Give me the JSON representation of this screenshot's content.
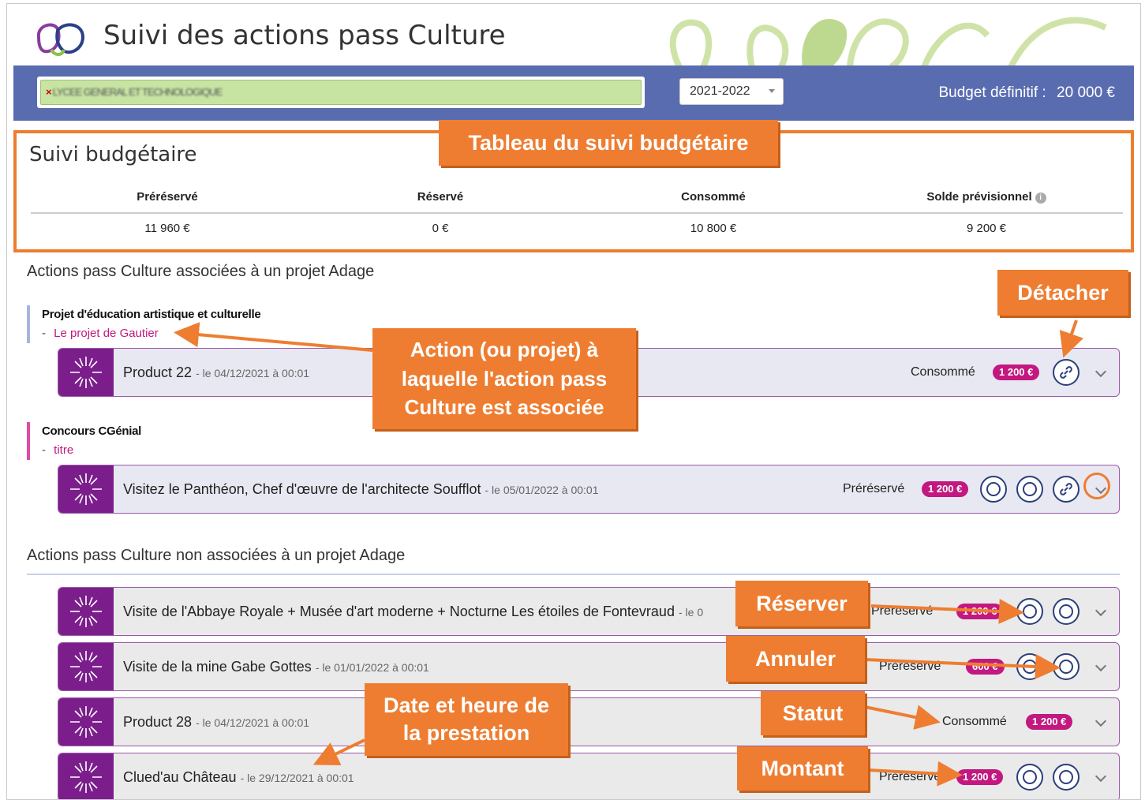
{
  "header": {
    "title": "Suivi des actions pass Culture"
  },
  "toolbar": {
    "establishment_value": "LYCEE GENERAL ET TECHNOLOGIQUE",
    "year_value": "2021-2022",
    "budget_label": "Budget définitif :",
    "budget_value": "20 000 €"
  },
  "budget_tracking": {
    "title": "Suivi budgétaire",
    "columns": [
      "Préréservé",
      "Réservé",
      "Consommé",
      "Solde prévisionnel"
    ],
    "values": [
      "11 960 €",
      "0 €",
      "10 800 €",
      "9 200 €"
    ]
  },
  "sections": {
    "associated": "Actions pass Culture associées à un projet Adage",
    "non_associated": "Actions pass Culture non associées à un projet Adage"
  },
  "projects": [
    {
      "type": "Projet d'éducation artistique et culturelle",
      "name": "Le projet de Gautier"
    },
    {
      "type": "Concours CGénial",
      "name": "titre"
    }
  ],
  "actions": [
    {
      "title": "Product 22",
      "date": "le 04/12/2021 à 00:01",
      "status": "Consommé",
      "amount": "1 200 €"
    },
    {
      "title": "Visitez le Panthéon, Chef d'œuvre de l'architecte Soufflot",
      "date": "le 05/01/2022 à 00:01",
      "status": "Préréservé",
      "amount": "1 200 €"
    },
    {
      "title": "Visite de l'Abbaye Royale + Musée d'art moderne + Nocturne Les étoiles de Fontevraud",
      "date": "le 0",
      "status": "Préréservé",
      "amount": "1 200 €"
    },
    {
      "title": "Visite de la mine Gabe Gottes",
      "date": "le 01/01/2022 à 00:01",
      "status": "Préréservé",
      "amount": "600 €"
    },
    {
      "title": "Product 28",
      "date": "le 04/12/2021 à 00:01",
      "status": "Consommé",
      "amount": "1 200 €"
    },
    {
      "title": "Clued'au Château",
      "date": "le 29/12/2021 à 00:01",
      "status": "Préréservé",
      "amount": "1 200 €"
    }
  ],
  "callouts": {
    "budget_table": "Tableau du suivi budgétaire",
    "detach": "Détacher",
    "linked_action": "Action (ou projet) à laquelle l'action pass Culture est associée",
    "reserve": "Réserver",
    "cancel": "Annuler",
    "status": "Statut",
    "datetime": "Date et heure de la prestation",
    "amount": "Montant"
  },
  "colors": {
    "header_bar": "#5a6cb0",
    "accent_orange": "#ee7d31",
    "badge_pink": "#c2187f",
    "thumb_purple": "#7b1e8c"
  }
}
